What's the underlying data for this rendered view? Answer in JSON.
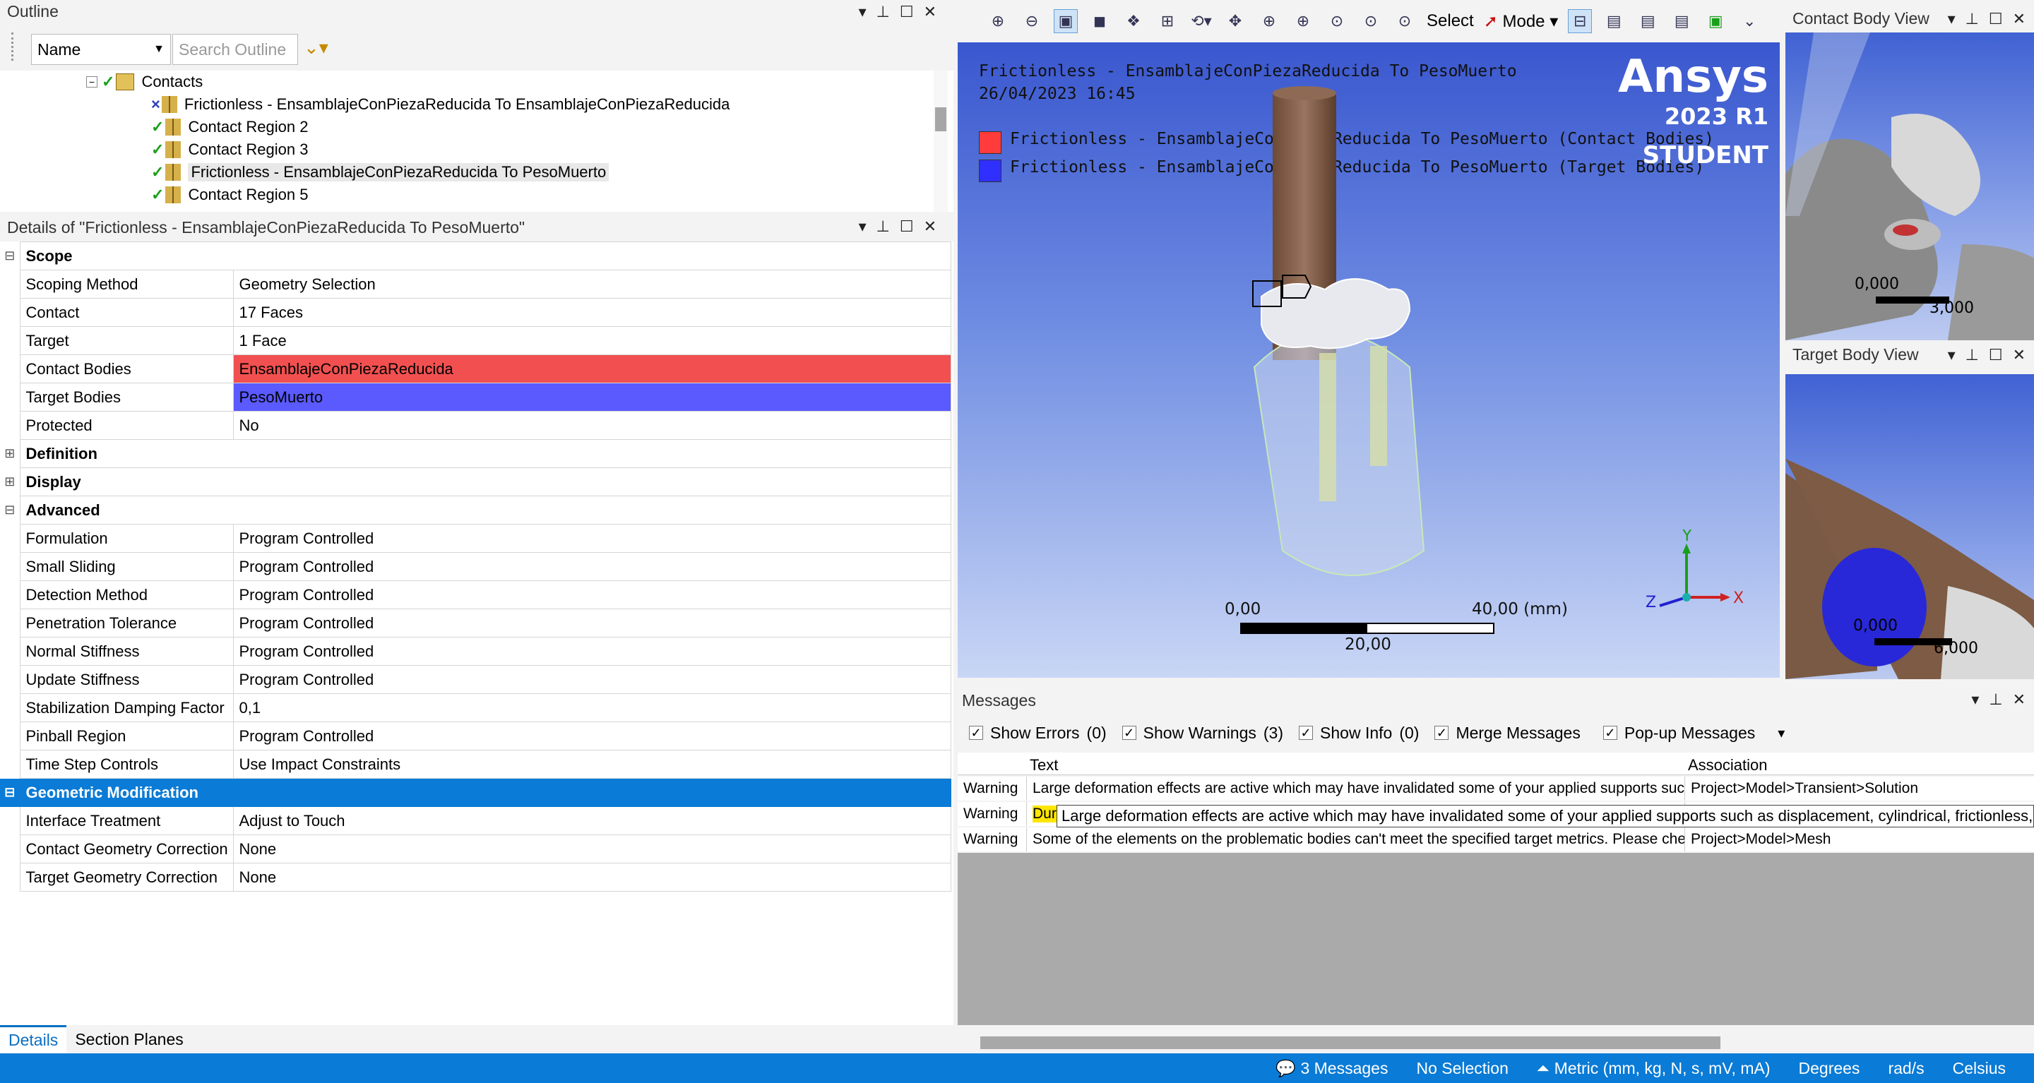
{
  "outline": {
    "title": "Outline",
    "name_dropdown": "Name",
    "search_placeholder": "Search Outline",
    "tree": [
      {
        "label": "Contacts",
        "status": "check"
      },
      {
        "label": "Frictionless - EnsamblajeConPiezaReducida To EnsamblajeConPiezaReducida",
        "status": "x"
      },
      {
        "label": "Contact Region 2",
        "status": "check"
      },
      {
        "label": "Contact Region 3",
        "status": "check"
      },
      {
        "label": "Frictionless - EnsamblajeConPiezaReducida To PesoMuerto",
        "status": "check"
      },
      {
        "label": "Contact Region 5",
        "status": "check"
      }
    ]
  },
  "details": {
    "title": "Details of \"Frictionless - EnsamblajeConPiezaReducida To PesoMuerto\"",
    "rows": [
      {
        "key": "Scope",
        "value": "",
        "type": "section",
        "exp": "⊟"
      },
      {
        "key": "Scoping Method",
        "value": "Geometry Selection"
      },
      {
        "key": "Contact",
        "value": "17 Faces"
      },
      {
        "key": "Target",
        "value": "1 Face"
      },
      {
        "key": "Contact Bodies",
        "value": "EnsamblajeConPiezaReducida",
        "type": "red"
      },
      {
        "key": "Target Bodies",
        "value": "PesoMuerto",
        "type": "blue"
      },
      {
        "key": "Protected",
        "value": "No"
      },
      {
        "key": "Definition",
        "value": "",
        "type": "section",
        "exp": "⊞"
      },
      {
        "key": "Display",
        "value": "",
        "type": "section",
        "exp": "⊞"
      },
      {
        "key": "Advanced",
        "value": "",
        "type": "section",
        "exp": "⊟"
      },
      {
        "key": "Formulation",
        "value": "Program Controlled"
      },
      {
        "key": "Small Sliding",
        "value": "Program Controlled"
      },
      {
        "key": "Detection Method",
        "value": "Program Controlled"
      },
      {
        "key": "Penetration Tolerance",
        "value": "Program Controlled"
      },
      {
        "key": "Normal Stiffness",
        "value": "Program Controlled"
      },
      {
        "key": "Update Stiffness",
        "value": "Program Controlled"
      },
      {
        "key": "Stabilization Damping Factor",
        "value": "0,1"
      },
      {
        "key": "Pinball Region",
        "value": "Program Controlled"
      },
      {
        "key": "Time Step Controls",
        "value": "Use Impact Constraints"
      },
      {
        "key": "Geometric Modification",
        "value": "",
        "type": "geo",
        "exp": "⊟"
      },
      {
        "key": "Interface Treatment",
        "value": "Adjust to Touch"
      },
      {
        "key": "Contact Geometry Correction",
        "value": "None"
      },
      {
        "key": "Target Geometry Correction",
        "value": "None"
      }
    ]
  },
  "bottom_tabs": {
    "details": "Details",
    "section_planes": "Section Planes"
  },
  "toolbar": {
    "select": "Select",
    "mode": "Mode"
  },
  "viewport": {
    "title": "Frictionless - EnsamblajeConPiezaReducida To PesoMuerto",
    "datetime": "26/04/2023 16:45",
    "legend_contact": "Frictionless - EnsamblajeConPiezaReducida To PesoMuerto (Contact Bodies)",
    "legend_target": "Frictionless - EnsamblajeConPiezaReducida To PesoMuerto (Target Bodies)",
    "logo": "Ansys",
    "version": "2023 R1",
    "edition": "STUDENT",
    "scale_min": "0,00",
    "scale_max": "40,00 (mm)",
    "scale_mid": "20,00",
    "colors": {
      "contact": "#ff3b3b",
      "target": "#2f2fff"
    }
  },
  "contact_view": {
    "title": "Contact Body View",
    "scale_min": "0,000",
    "scale_max": "3,000"
  },
  "target_view": {
    "title": "Target Body View",
    "scale_min": "0,000",
    "scale_max": "6,000"
  },
  "messages": {
    "title": "Messages",
    "filters": [
      {
        "label": "Show Errors",
        "count": "(0)"
      },
      {
        "label": "Show Warnings",
        "count": "(3)"
      },
      {
        "label": "Show Info",
        "count": "(0)"
      },
      {
        "label": "Merge Messages",
        "count": ""
      },
      {
        "label": "Pop-up Messages",
        "count": ""
      }
    ],
    "columns": [
      "Text",
      "Association"
    ],
    "rows": [
      {
        "type": "Warning",
        "text": "Large deformation effects are active which may have invalidated some of your applied supports such",
        "assoc": "Project>Model>Transient>Solution"
      },
      {
        "type": "Warning",
        "text": "Dur",
        "assoc": ""
      },
      {
        "type": "Warning",
        "text": "Some of the elements on the problematic bodies can't meet the specified target metrics. Please che",
        "assoc": "Project>Model>Mesh"
      }
    ],
    "tooltip": "Large deformation effects are active which may have invalidated some of your applied supports such as displacement, cylindrical, frictionless, o"
  },
  "status": {
    "messages": "3 Messages",
    "selection": "No Selection",
    "units": "Metric (mm, kg, N, s, mV, mA)",
    "angle": "Degrees",
    "rot": "rad/s",
    "temp": "Celsius"
  }
}
